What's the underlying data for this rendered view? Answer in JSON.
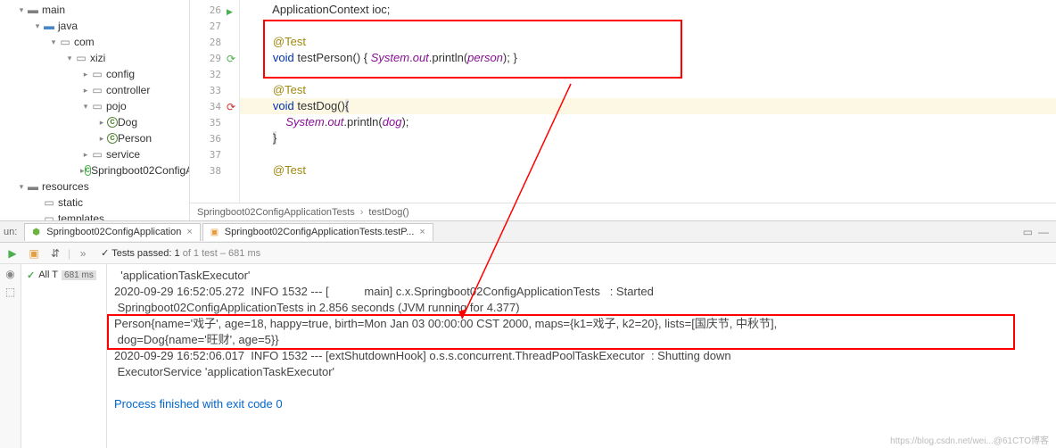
{
  "tree": {
    "main": "main",
    "java": "java",
    "com": "com",
    "xizi": "xizi",
    "config": "config",
    "controller": "controller",
    "pojo": "pojo",
    "dog": "Dog",
    "person": "Person",
    "service": "service",
    "springcfg": "Springboot02ConfigA",
    "resources": "resources",
    "static": "static",
    "templates": "templates"
  },
  "gutter": {
    "l26": "26",
    "l27": "27",
    "l28": "28",
    "l29": "29",
    "l32": "32",
    "l33": "33",
    "l34": "34",
    "l35": "35",
    "l36": "36",
    "l37": "37",
    "l38": "38"
  },
  "code": {
    "l26_a": "        ApplicationContext ioc;",
    "l28_anno": "        @Test",
    "l29_pre": "        ",
    "l29_kw": "void",
    "l29_m": " testPerson() { ",
    "l29_sys": "System",
    "l29_dot1": ".",
    "l29_out": "out",
    "l29_dot2": ".println(",
    "l29_arg": "person",
    "l29_end": "); }",
    "l33_anno": "        @Test",
    "l34_pre": "        ",
    "l34_kw": "void",
    "l34_m": " testDog()",
    "l34_brace": "{",
    "l35_pre": "            ",
    "l35_sys": "System",
    "l35_dot1": ".",
    "l35_out": "out",
    "l35_dot2": ".println(",
    "l35_arg": "dog",
    "l35_end": ");",
    "l36_pre": "        ",
    "l36_brace": "}",
    "l38_anno": "        @Test"
  },
  "breadcrumb": {
    "a": "Springboot02ConfigApplicationTests",
    "b": "testDog()"
  },
  "runTabs": {
    "label": "un:",
    "tab1": "Springboot02ConfigApplication",
    "tab2": "Springboot02ConfigApplicationTests.testP..."
  },
  "toolbar": {
    "passed": "Tests passed: 1",
    "total": " of 1 test – 681 ms"
  },
  "testTree": {
    "root": "All T",
    "time": "681 ms"
  },
  "console": {
    "l1": "  'applicationTaskExecutor'",
    "l2": "2020-09-29 16:52:05.272  INFO 1532 --- [           main] c.x.Springboot02ConfigApplicationTests   : Started ",
    "l3": " Springboot02ConfigApplicationTests in 2.856 seconds (JVM running for 4.377)",
    "l4": "Person{name='戏子', age=18, happy=true, birth=Mon Jan 03 00:00:00 CST 2000, maps={k1=戏子, k2=20}, lists=[国庆节, 中秋节], ",
    "l5": " dog=Dog{name='旺财', age=5}}",
    "l6": "2020-09-29 16:52:06.017  INFO 1532 --- [extShutdownHook] o.s.s.concurrent.ThreadPoolTaskExecutor  : Shutting down ",
    "l7": " ExecutorService 'applicationTaskExecutor'",
    "l9": "Process finished with exit code 0"
  },
  "watermark": "https://blog.csdn.net/wei...@61CTO博客"
}
